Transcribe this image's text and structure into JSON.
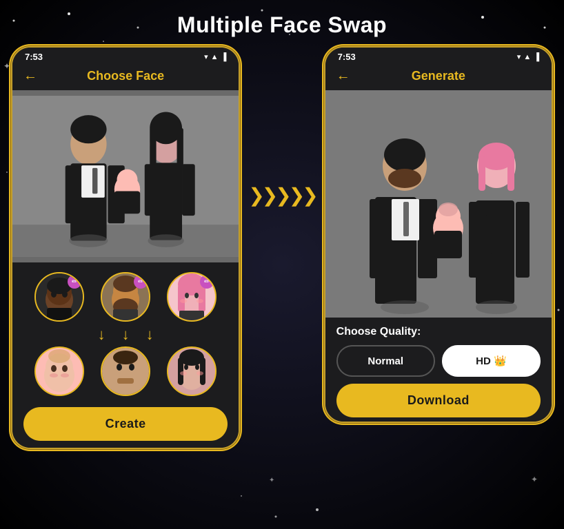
{
  "page": {
    "title": "Multiple Face Swap",
    "background_color": "#000"
  },
  "phone1": {
    "status_time": "7:53",
    "header_title": "Choose Face",
    "back_arrow": "←",
    "create_button": "Create",
    "face_sources": [
      {
        "id": "face1",
        "emoji": "👦🏾",
        "color": "#5c3317"
      },
      {
        "id": "face2",
        "emoji": "🧔",
        "color": "#8B7355"
      },
      {
        "id": "face3",
        "emoji": "👩🏻",
        "color": "#FFB6C1"
      }
    ],
    "face_targets": [
      {
        "id": "target1",
        "emoji": "👶",
        "color": "#FDBCB4"
      },
      {
        "id": "target2",
        "emoji": "🧑",
        "color": "#8B6914"
      },
      {
        "id": "target3",
        "emoji": "👩",
        "color": "#D4A0A0"
      }
    ]
  },
  "phone2": {
    "status_time": "7:53",
    "header_title": "Generate",
    "back_arrow": "←",
    "quality_label": "Choose Quality:",
    "quality_normal": "Normal",
    "quality_hd": "HD 👑",
    "download_button": "Download"
  },
  "arrow_between": "❯❯❯❯❯",
  "icons": {
    "signal": "▼",
    "wifi": "▲",
    "battery": "🔋",
    "edit": "✏",
    "arrow_down": "↓"
  }
}
